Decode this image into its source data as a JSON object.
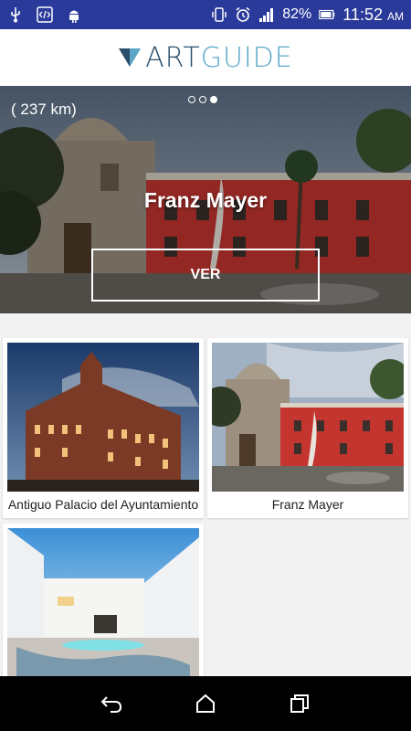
{
  "status_bar": {
    "battery": "82%",
    "time": "11:52",
    "ampm": "AM",
    "icons": [
      "usb-icon",
      "code-icon",
      "android-icon",
      "vibrate-icon",
      "alarm-icon",
      "signal-icon",
      "battery-icon"
    ]
  },
  "header": {
    "logo_art": "ART",
    "logo_guide": "GUIDE"
  },
  "hero": {
    "distance": "( 237 km)",
    "title": "Franz Mayer",
    "button_label": "VER",
    "carousel": {
      "count": 3,
      "active_index": 2
    }
  },
  "cards": [
    {
      "label": "Antiguo Palacio del Ayuntamiento"
    },
    {
      "label": "Franz Mayer"
    },
    {
      "label": ""
    }
  ],
  "navbar": {
    "icons": [
      "back-icon",
      "home-icon",
      "recents-icon"
    ]
  },
  "colors": {
    "status_bar": "#2a3a9a",
    "logo_dark": "#2b4f6b",
    "logo_light": "#5aa7c8"
  }
}
